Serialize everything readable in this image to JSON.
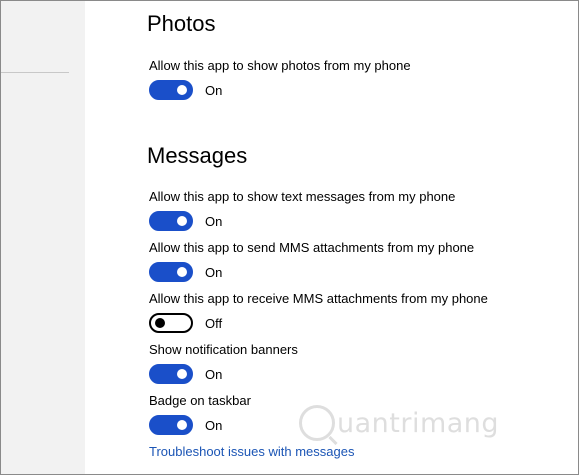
{
  "colors": {
    "toggle_on": "#1a4fc9",
    "link": "#1b55b5",
    "sidebar_bg": "#f2f2f2"
  },
  "photos": {
    "title": "Photos",
    "settings": [
      {
        "label": "Allow this app to show photos from my phone",
        "state": "On",
        "on": true
      }
    ]
  },
  "messages": {
    "title": "Messages",
    "settings": [
      {
        "label": "Allow this app to show text messages from my phone",
        "state": "On",
        "on": true
      },
      {
        "label": "Allow this app to send MMS attachments from my phone",
        "state": "On",
        "on": true
      },
      {
        "label": "Allow this app to receive MMS attachments from my phone",
        "state": "Off",
        "on": false
      },
      {
        "label": "Show notification banners",
        "state": "On",
        "on": true
      },
      {
        "label": "Badge on taskbar",
        "state": "On",
        "on": true
      }
    ],
    "troubleshoot_link": "Troubleshoot issues with messages"
  },
  "watermark": {
    "text": "uantrimang",
    "icon": "magnifier-q-icon"
  }
}
